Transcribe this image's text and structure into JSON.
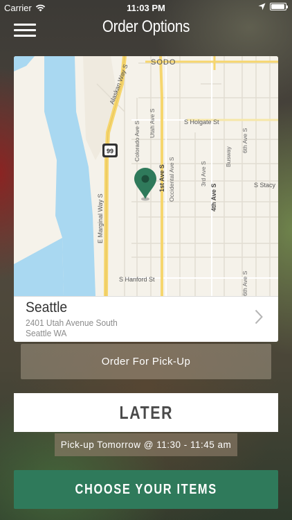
{
  "status_bar": {
    "carrier": "Carrier",
    "time": "11:03 PM"
  },
  "nav": {
    "title": "Order Options"
  },
  "map": {
    "labels": {
      "sodo": "SODO",
      "alaskan_way": "Alaskan Way S",
      "marginal_way": "E Marginal Way S",
      "highway": "99",
      "colorado": "Colorado Ave S",
      "utah": "Utah Ave S",
      "first_ave": "1st Ave S",
      "occidental": "Occidental Ave S",
      "third_ave": "3rd Ave S",
      "fourth_ave": "4th Ave S",
      "busway": "Busway",
      "sixth_ave": "6th Ave S",
      "holgate": "S Holgate St",
      "stacy": "S Stacy",
      "hanford": "S Hanford St"
    },
    "colors": {
      "water": "#a9d8f1",
      "land": "#f5f2ea",
      "major_road": "#f6d66e",
      "pin": "#2f7a5b"
    }
  },
  "location": {
    "city": "Seattle",
    "address": "2401 Utah Avenue South",
    "city_state": "Seattle WA"
  },
  "pickup": {
    "order_label": "Order For Pick-Up",
    "later_label": "LATER",
    "time_label": "Pick-up Tomorrow @ 11:30 - 11:45 am"
  },
  "actions": {
    "choose_label": "CHOOSE YOUR ITEMS"
  }
}
